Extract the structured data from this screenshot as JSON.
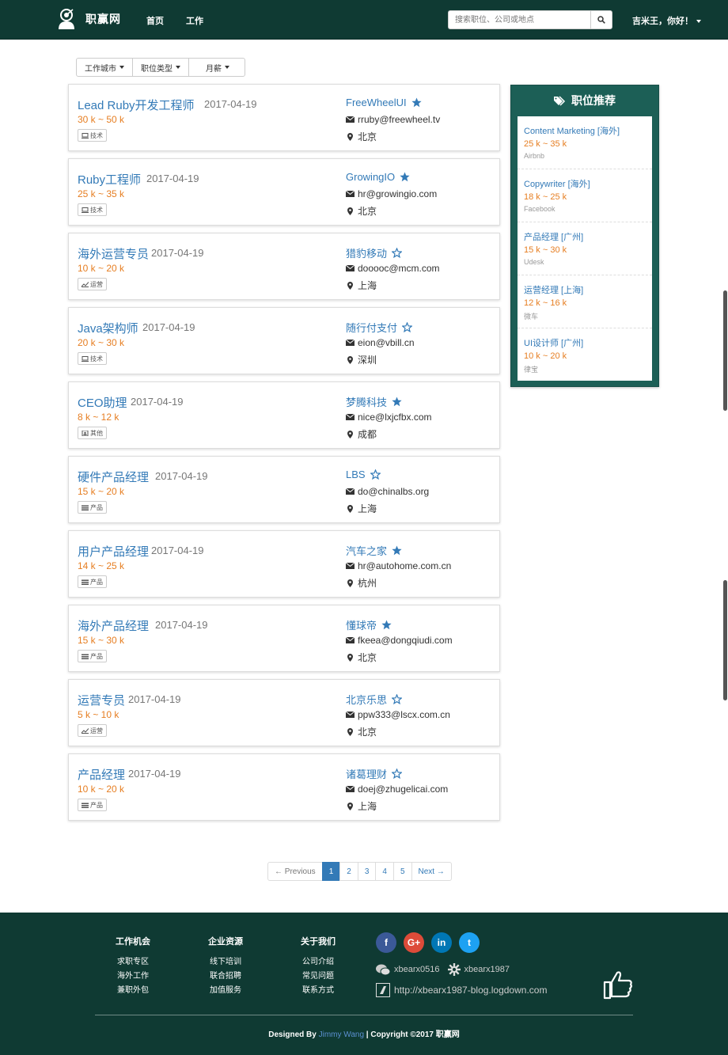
{
  "navbar": {
    "brand": "职赢网",
    "links": [
      "首页",
      "工作"
    ],
    "search_placeholder": "搜索职位、公司或地点",
    "user": "吉米王，你好！"
  },
  "filters": [
    "工作城市",
    "职位类型",
    "月薪"
  ],
  "jobs": [
    {
      "title": "Lead Ruby开发工程师",
      "date": "2017-04-19",
      "salary": "30 k ~ 50 k",
      "tag": "技术",
      "tag_icon": "laptop-icon",
      "company": "FreeWheelUI",
      "starred": true,
      "email": "rruby@freewheel.tv",
      "city": "北京"
    },
    {
      "title": "Ruby工程师",
      "date": "2017-04-19",
      "salary": "25 k ~ 35 k",
      "tag": "技术",
      "tag_icon": "laptop-icon",
      "company": "GrowingIO",
      "starred": true,
      "email": "hr@growingio.com",
      "city": "北京"
    },
    {
      "title": "海外运营专员",
      "date": "2017-04-19",
      "salary": "10 k ~ 20 k",
      "tag": "运营",
      "tag_icon": "chart-icon",
      "company": "猎豹移动",
      "starred": false,
      "email": "dooooc@mcm.com",
      "city": "上海"
    },
    {
      "title": "Java架构师",
      "date": "2017-04-19",
      "salary": "20 k ~ 30 k",
      "tag": "技术",
      "tag_icon": "laptop-icon",
      "company": "随行付支付",
      "starred": false,
      "email": "eion@vbill.cn",
      "city": "深圳"
    },
    {
      "title": "CEO助理",
      "date": "2017-04-19",
      "salary": "8 k ~ 12 k",
      "tag": "其他",
      "tag_icon": "contact-icon",
      "company": "梦腾科技",
      "starred": true,
      "email": "nice@lxjcfbx.com",
      "city": "成都"
    },
    {
      "title": "硬件产品经理",
      "date": "2017-04-19",
      "salary": "15 k ~ 20 k",
      "tag": "产品",
      "tag_icon": "list-icon",
      "company": "LBS",
      "starred": false,
      "email": "do@chinalbs.org",
      "city": "上海"
    },
    {
      "title": "用户产品经理",
      "date": "2017-04-19",
      "salary": "14 k ~ 25 k",
      "tag": "产品",
      "tag_icon": "list-icon",
      "company": "汽车之家",
      "starred": true,
      "email": "hr@autohome.com.cn",
      "city": "杭州"
    },
    {
      "title": "海外产品经理",
      "date": "2017-04-19",
      "salary": "15 k ~ 30 k",
      "tag": "产品",
      "tag_icon": "list-icon",
      "company": "懂球帝",
      "starred": true,
      "email": "fkeea@dongqiudi.com",
      "city": "北京"
    },
    {
      "title": "运营专员",
      "date": "2017-04-19",
      "salary": "5 k ~ 10 k",
      "tag": "运营",
      "tag_icon": "chart-icon",
      "company": "北京乐思",
      "starred": false,
      "email": "ppw333@lscx.com.cn",
      "city": "北京"
    },
    {
      "title": "产品经理",
      "date": "2017-04-19",
      "salary": "10 k ~ 20 k",
      "tag": "产品",
      "tag_icon": "list-icon",
      "company": "诸葛理财",
      "starred": false,
      "email": "doej@zhugelicai.com",
      "city": "上海"
    }
  ],
  "recommend": {
    "title": "职位推荐",
    "items": [
      {
        "title": "Content Marketing [海外]",
        "salary": "25 k ~ 35 k",
        "company": "Airbnb"
      },
      {
        "title": "Copywriter [海外]",
        "salary": "18 k ~ 25 k",
        "company": "Facebook"
      },
      {
        "title": "产品经理 [广州]",
        "salary": "15 k ~ 30 k",
        "company": "Udesk"
      },
      {
        "title": "运营经理 [上海]",
        "salary": "12 k ~ 16 k",
        "company": "微车"
      },
      {
        "title": "UI设计师 [广州]",
        "salary": "10 k ~ 20 k",
        "company": "律宝"
      }
    ]
  },
  "pagination": {
    "prev": "← Previous",
    "pages": [
      "1",
      "2",
      "3",
      "4",
      "5"
    ],
    "next": "Next →",
    "active": "1"
  },
  "footer": {
    "columns": [
      {
        "head": "工作机会",
        "links": [
          "求职专区",
          "海外工作",
          "兼职外包"
        ]
      },
      {
        "head": "企业资源",
        "links": [
          "线下培训",
          "联合招聘",
          "加值服务"
        ]
      },
      {
        "head": "关于我们",
        "links": [
          "公司介绍",
          "常见问题",
          "联系方式"
        ]
      }
    ],
    "social": [
      {
        "name": "facebook-icon",
        "glyph": "f",
        "color": "#3b5998"
      },
      {
        "name": "google-plus-icon",
        "glyph": "G+",
        "color": "#dd4b39"
      },
      {
        "name": "linkedin-icon",
        "glyph": "in",
        "color": "#0077b5"
      },
      {
        "name": "twitter-icon",
        "glyph": "t",
        "color": "#1da1f2"
      }
    ],
    "wechat": "xbearx0516",
    "weibo": "xbearx1987",
    "blog": "http://xbearx1987-blog.logdown.com",
    "copyright_prefix": "Designed By ",
    "author": "Jimmy Wang",
    "copyright_suffix": " | Copyright ©2017 职赢网"
  }
}
